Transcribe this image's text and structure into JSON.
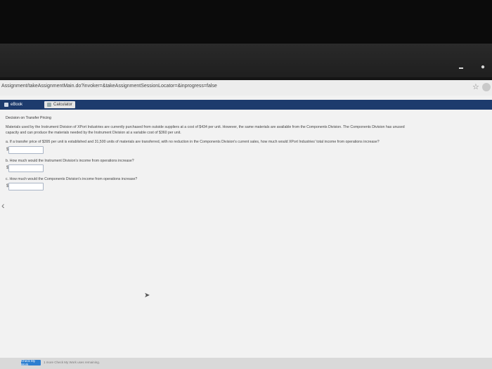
{
  "browser": {
    "url": "Assignment/takeAssignmentMain.do?invoker=&takeAssignmentSessionLocator=&inprogress=false",
    "icons": [
      "star-icon",
      "profile-icon"
    ]
  },
  "toolbar": {
    "ebook_label": "eBook",
    "calculator_label": "Calculator"
  },
  "problem": {
    "title": "Decision on Transfer Pricing",
    "paragraph_line1": "Materials used by the Instrument Division of XPort Industries are currently purchased from outside suppliers at a cost of $434 per unit. However, the same materials are available from the Components Division. The Components Division has unused",
    "paragraph_line2": "capacity and can produce the materials needed by the Instrument Division at a variable cost of $360 per unit.",
    "part_a": "a.  If a transfer price of $395 per unit is established and 31,500 units of materials are transferred, with no reduction in the Components Division's current sales, how much would XPort Industries' total income from operations increase?",
    "part_b": "b.  How much would the Instrument Division's income from operations increase?",
    "part_c": "c.  How much would the Components Division's income from operations increase?",
    "currency_symbol": "$"
  },
  "footer": {
    "check_button": "Check My Work",
    "note": "1 more Check My Work uses remaining."
  }
}
